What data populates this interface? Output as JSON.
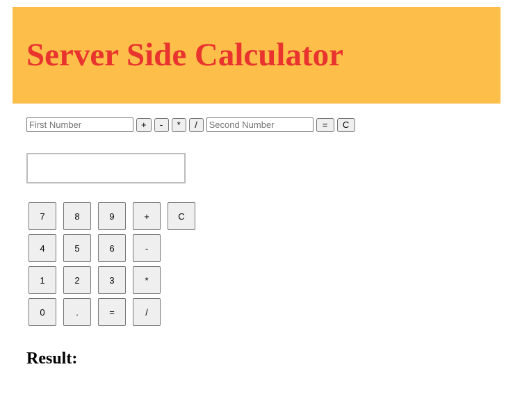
{
  "header": {
    "title": "Server Side Calculator"
  },
  "colors": {
    "header_background": "#fdbf49",
    "title_color": "#e8332f"
  },
  "form": {
    "first_number": {
      "value": "",
      "placeholder": "First Number"
    },
    "second_number": {
      "value": "",
      "placeholder": "Second Number"
    },
    "add_label": "+",
    "subtract_label": "-",
    "multiply_label": "*",
    "divide_label": "/",
    "equals_label": "=",
    "clear_label": "C"
  },
  "display": {
    "value": ""
  },
  "keypad": {
    "rows": [
      [
        "7",
        "8",
        "9",
        "+",
        "C"
      ],
      [
        "4",
        "5",
        "6",
        "-"
      ],
      [
        "1",
        "2",
        "3",
        "*"
      ],
      [
        "0",
        ".",
        "=",
        "/"
      ]
    ]
  },
  "result": {
    "label": "Result:"
  }
}
